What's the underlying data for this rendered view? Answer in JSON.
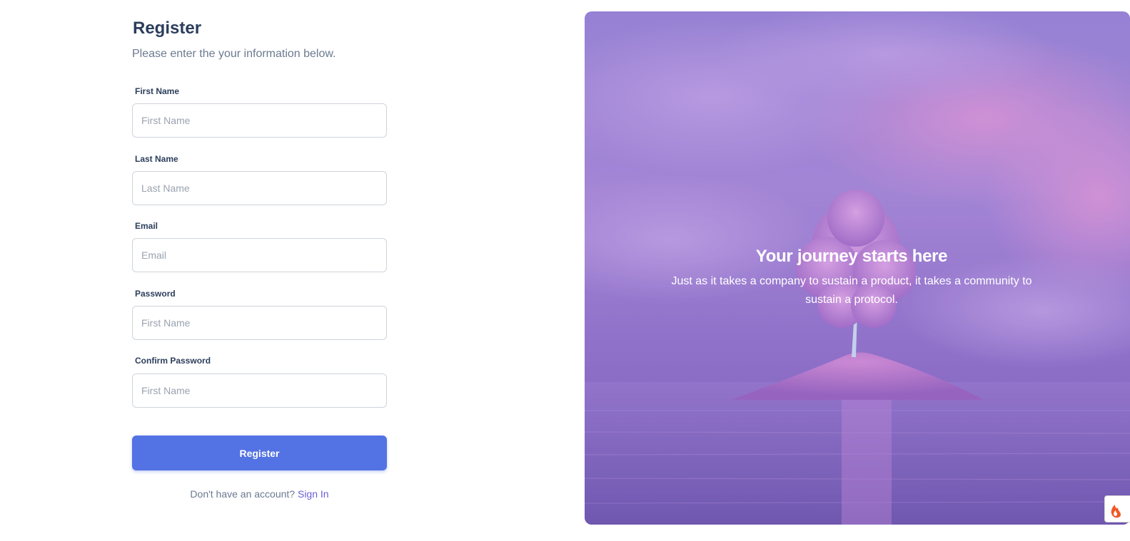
{
  "form": {
    "title": "Register",
    "subtitle": "Please enter the your information below.",
    "fields": [
      {
        "label": "First Name",
        "placeholder": "First Name",
        "value": ""
      },
      {
        "label": "Last Name",
        "placeholder": "Last Name",
        "value": ""
      },
      {
        "label": "Email",
        "placeholder": "Email",
        "value": ""
      },
      {
        "label": "Password",
        "placeholder": "First Name",
        "value": ""
      },
      {
        "label": "Confirm Password",
        "placeholder": "First Name",
        "value": ""
      }
    ],
    "submit_label": "Register",
    "footer_prompt": "Don't have an account?",
    "footer_link": "Sign In"
  },
  "hero": {
    "title": "Your journey starts here",
    "description": "Just as it takes a company to sustain a product, it takes a community to sustain a protocol."
  },
  "colors": {
    "accent": "#5372e3",
    "link": "#6a5fd8",
    "heading": "#2c3e5c",
    "hero_tint": "#9b7fd4"
  },
  "icons": {
    "corner_badge": "flame-icon",
    "hero_image": "tree-on-island-image"
  }
}
